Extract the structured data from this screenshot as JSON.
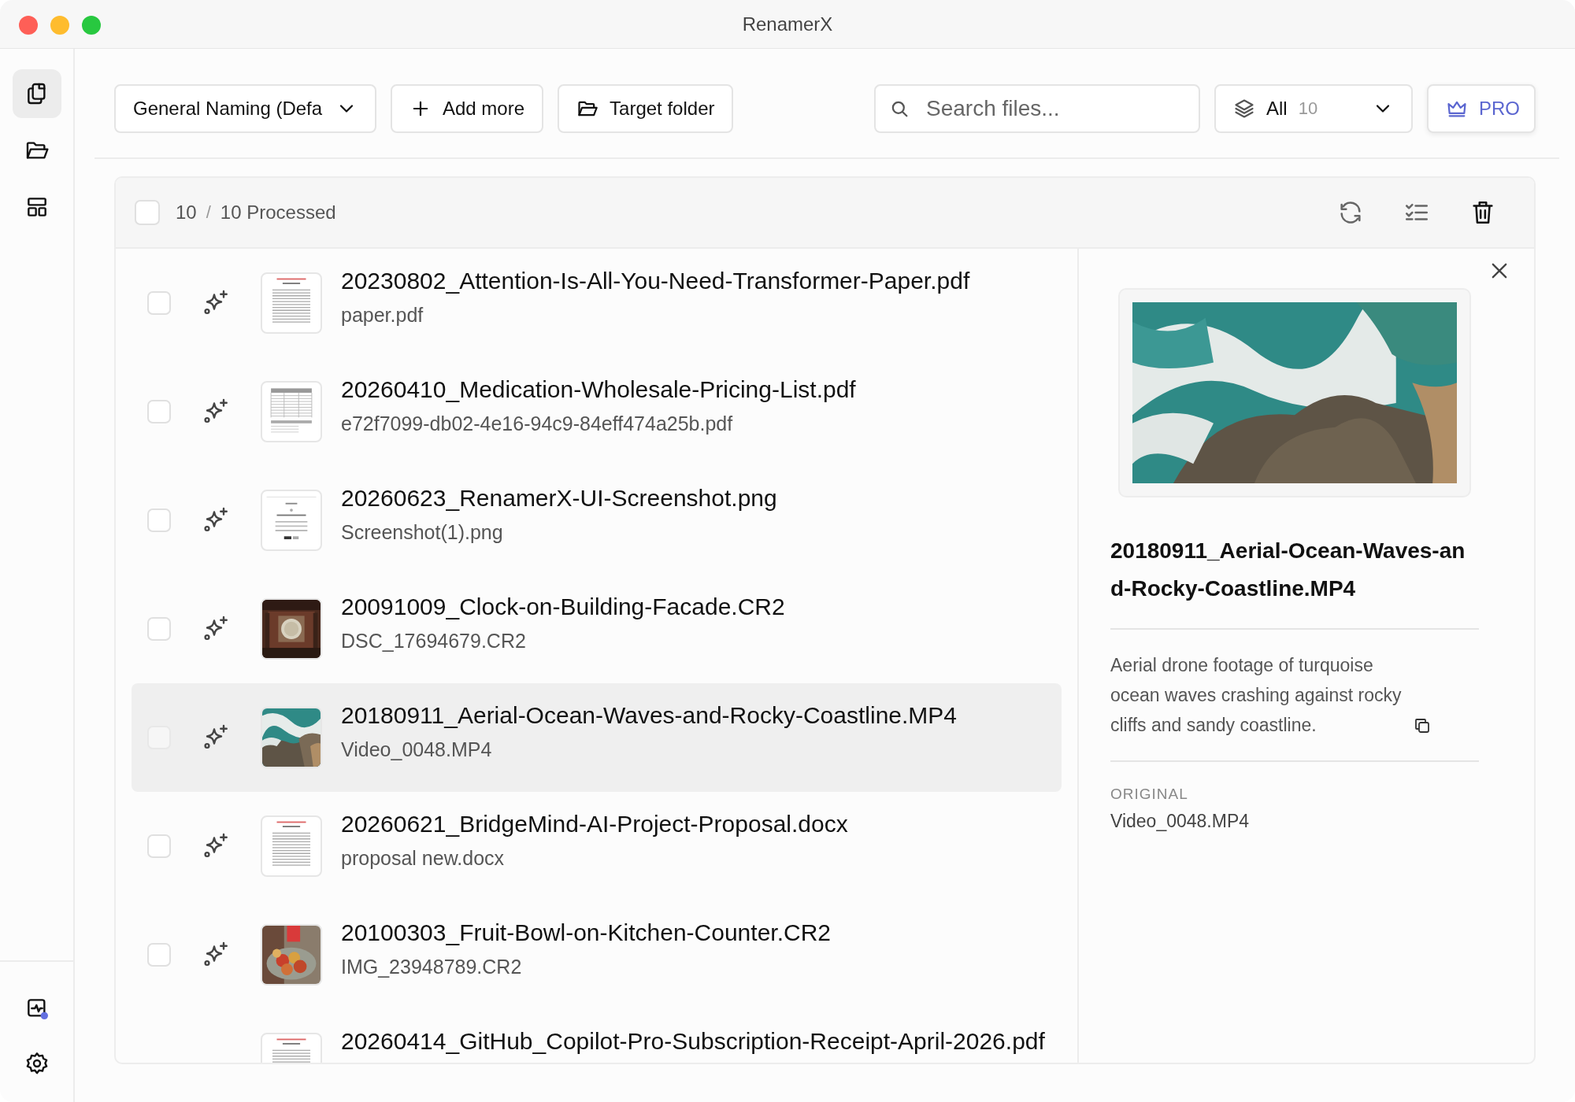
{
  "window": {
    "title": "RenamerX"
  },
  "sidebar": {
    "top_items": [
      {
        "kind": "files",
        "selected": true
      },
      {
        "kind": "folder",
        "selected": false
      },
      {
        "kind": "layout",
        "selected": false
      }
    ],
    "bottom_items": [
      {
        "kind": "activity",
        "badge_dot": true
      },
      {
        "kind": "settings"
      }
    ]
  },
  "toolbar": {
    "preset_dropdown": {
      "value": "General Naming (Defa"
    },
    "add_button": "Add more",
    "target_button": "Target folder",
    "search": {
      "placeholder": "Search files..."
    },
    "filter": {
      "label": "All",
      "count": "10"
    },
    "pro_button": "PRO"
  },
  "list_header": {
    "checked": false,
    "count": "10",
    "separator": "/",
    "processed": "10 Processed"
  },
  "files": [
    {
      "name": "20230802_Attention-Is-All-You-Need-Transformer-Paper.pdf",
      "original": "paper.pdf",
      "kind": "document",
      "checked": false,
      "selected": false
    },
    {
      "name": "20260410_Medication-Wholesale-Pricing-List.pdf",
      "original": "e72f7099-db02-4e16-94c9-84eff474a25b.pdf",
      "kind": "table",
      "checked": false,
      "selected": false
    },
    {
      "name": "20260623_RenamerX-UI-Screenshot.png",
      "original": "Screenshot(1).png",
      "kind": "screenshot",
      "checked": false,
      "selected": false
    },
    {
      "name": "20091009_Clock-on-Building-Facade.CR2",
      "original": "DSC_17694679.CR2",
      "kind": "picture",
      "checked": false,
      "selected": false
    },
    {
      "name": "20180911_Aerial-Ocean-Waves-and-Rocky-Coastline.MP4",
      "original": "Video_0048.MP4",
      "kind": "picture",
      "checked": false,
      "selected": true
    },
    {
      "name": "20260621_BridgeMind-AI-Project-Proposal.docx",
      "original": "proposal new.docx",
      "kind": "document",
      "checked": false,
      "selected": false
    },
    {
      "name": "20100303_Fruit-Bowl-on-Kitchen-Counter.CR2",
      "original": "IMG_23948789.CR2",
      "kind": "picture",
      "checked": false,
      "selected": false
    },
    {
      "name": "20260414_GitHub_Copilot-Pro-Subscription-Receipt-April-2026.pdf",
      "kind": "document",
      "selected": false
    }
  ],
  "detail": {
    "title": "20180911_Aerial-Ocean-Waves-and-Rocky-Coastline.MP4",
    "description": "Aerial drone footage of turquoise ocean waves crashing against rocky cliffs and sandy coastline.",
    "original_label": "ORIGINAL",
    "original": "Video_0048.MP4"
  }
}
